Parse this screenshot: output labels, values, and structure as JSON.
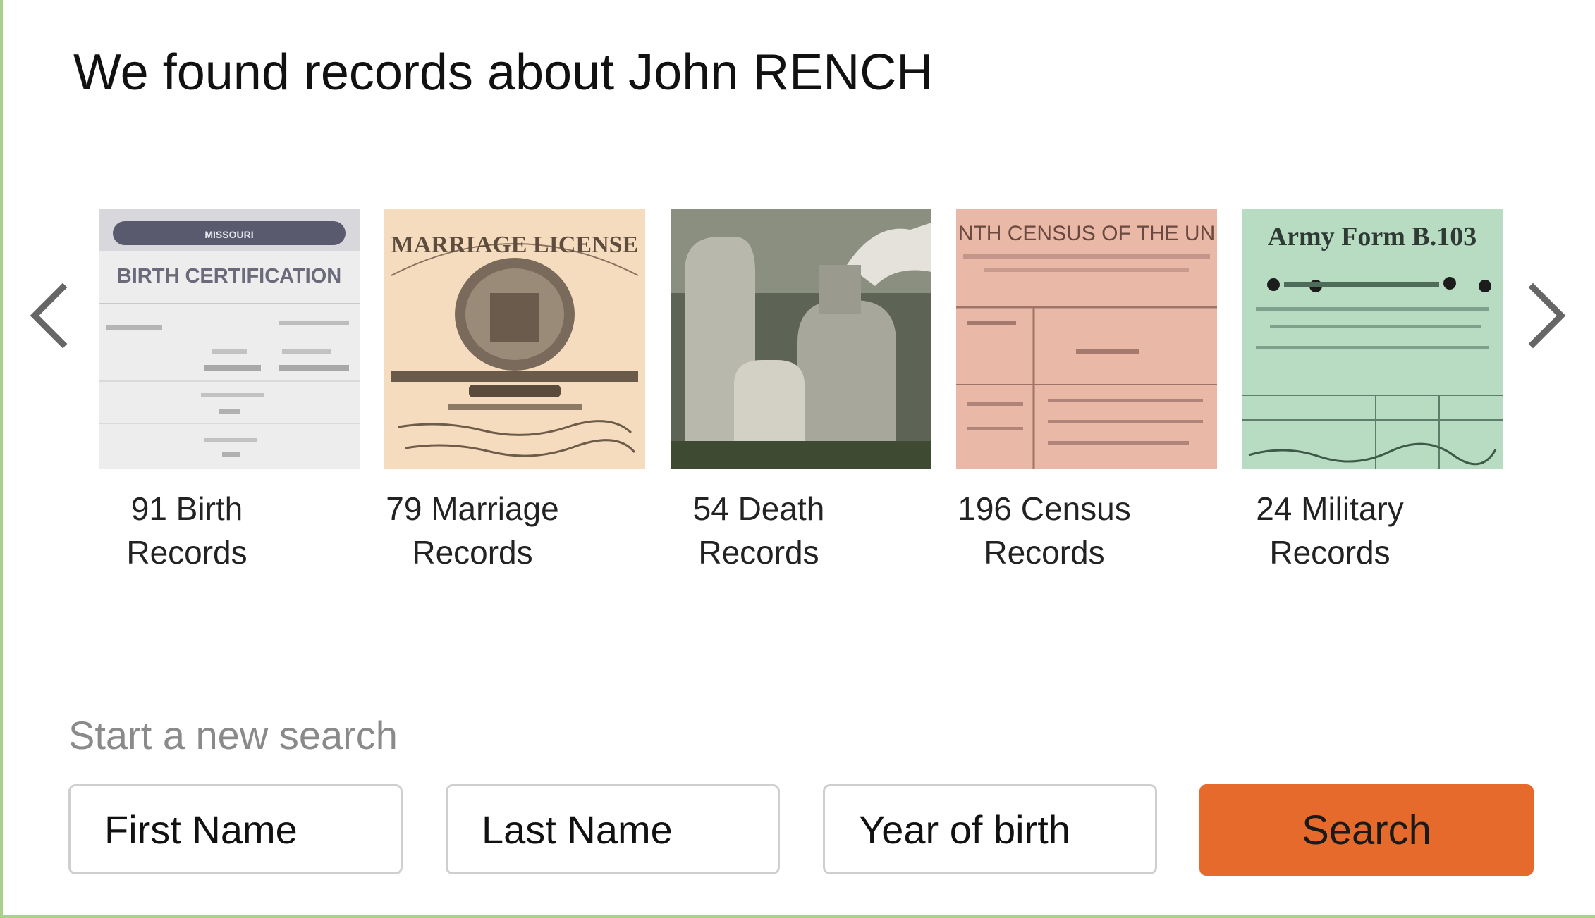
{
  "header": {
    "title": "We found records about John RENCH"
  },
  "carousel": {
    "prev_icon": "chevron-left-icon",
    "next_icon": "chevron-right-icon",
    "arrow_color": "#666666",
    "cards": [
      {
        "line1": "91 Birth",
        "line2": "Records",
        "thumb_title": "BIRTH CERTIFICATION",
        "thumb_banner": "MISSOURI",
        "thumb_bg": "#eeeeee"
      },
      {
        "line1": "79 Marriage",
        "line2": "Records",
        "thumb_title": "MARRIAGE LICENSE",
        "thumb_bg": "#f5dcc0"
      },
      {
        "line1": "54 Death",
        "line2": "Records",
        "thumb_bg": "#6f7565"
      },
      {
        "line1": "196 Census",
        "line2": "Records",
        "thumb_title": "NTH CENSUS OF THE UN",
        "thumb_bg": "#e8b9a8"
      },
      {
        "line1": "24 Military",
        "line2": "Records",
        "thumb_title": "Army Form B.103",
        "thumb_bg": "#b9dcc3"
      }
    ]
  },
  "new_search": {
    "label": "Start a new search",
    "first_name_placeholder": "First Name",
    "last_name_placeholder": "Last Name",
    "year_placeholder": "Year of birth",
    "button_label": "Search",
    "button_color": "#e56a2c"
  }
}
